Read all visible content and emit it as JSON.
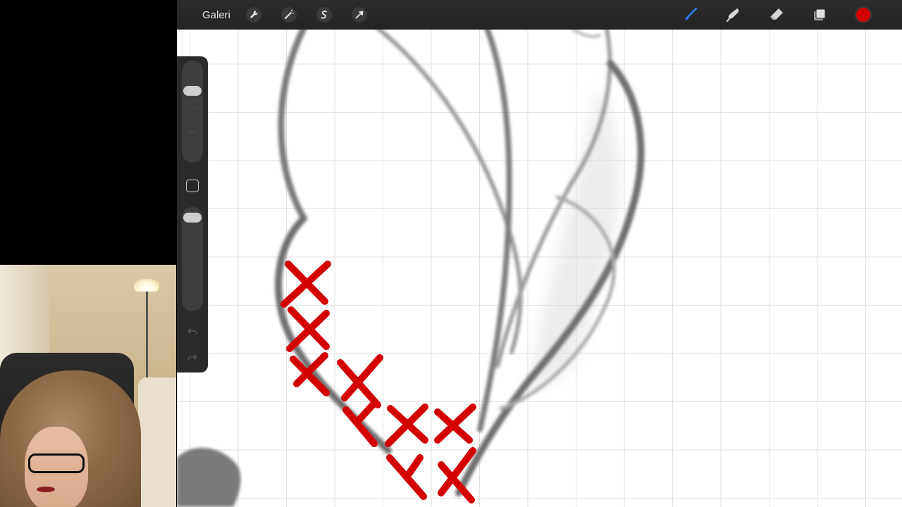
{
  "toolbar": {
    "gallery_label": "Galeri",
    "left_tools": [
      {
        "name": "actions",
        "icon": "wrench-icon"
      },
      {
        "name": "adjustments",
        "icon": "magic-wand-icon"
      },
      {
        "name": "selection",
        "icon": "selection-s-icon"
      },
      {
        "name": "transform",
        "icon": "arrow-cursor-icon"
      }
    ],
    "right_tools": [
      {
        "name": "brush",
        "icon": "brush-icon",
        "active": true
      },
      {
        "name": "smudge",
        "icon": "smudge-finger-icon"
      },
      {
        "name": "eraser",
        "icon": "eraser-icon"
      },
      {
        "name": "layers",
        "icon": "layers-icon"
      }
    ],
    "active_color": "#d40000",
    "active_tool_color": "#2d7cf6"
  },
  "sidebar": {
    "brush_size_level": 0.92,
    "opacity_level": 1.0
  },
  "colors": {
    "accent": "#2d7cf6",
    "annotation": "#d40000",
    "toolbar_bg": "#262626"
  }
}
